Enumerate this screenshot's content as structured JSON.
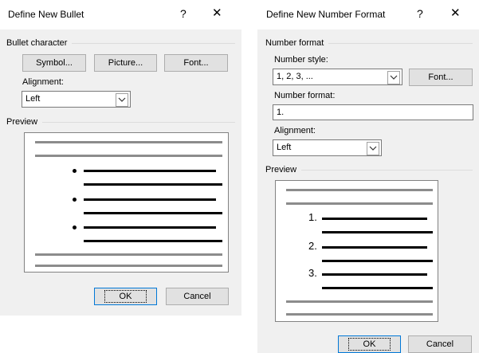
{
  "bullet_dialog": {
    "title": "Define New Bullet",
    "help": "?",
    "close": "✕",
    "section_bullet": "Bullet character",
    "symbol_btn": "Symbol...",
    "picture_btn": "Picture...",
    "font_btn": "Font...",
    "alignment_label": "Alignment:",
    "alignment_value": "Left",
    "preview_label": "Preview",
    "ok": "OK",
    "cancel": "Cancel"
  },
  "number_dialog": {
    "title": "Define New Number Format",
    "help": "?",
    "close": "✕",
    "section_number": "Number format",
    "number_style_label": "Number style:",
    "number_style_value": "1, 2, 3, ...",
    "font_btn": "Font...",
    "number_format_label": "Number format:",
    "number_format_value": "1.",
    "alignment_label": "Alignment:",
    "alignment_value": "Left",
    "preview_label": "Preview",
    "preview_numbers": [
      "1.",
      "2.",
      "3."
    ],
    "ok": "OK",
    "cancel": "Cancel"
  },
  "colors": {
    "accent": "#0078d7",
    "dialog_bg": "#f0f0f0",
    "preview_gray": "#8c8c8c"
  },
  "icons": {
    "combo_arrow": "chevron-down-icon",
    "close": "close-icon",
    "help": "help-icon"
  }
}
